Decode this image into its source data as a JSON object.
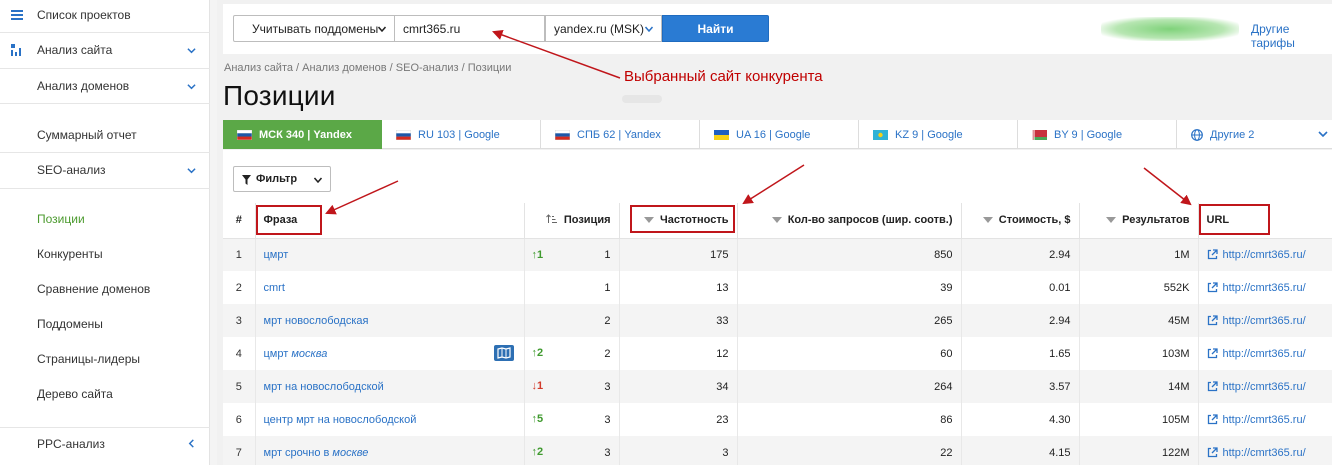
{
  "sidebar": {
    "projects_label": "Список проектов",
    "site_analysis_label": "Анализ сайта",
    "domain_analysis_label": "Анализ доменов",
    "summary_label": "Суммарный отчет",
    "seo_label": "SEO-анализ",
    "positions_label": "Позиции",
    "competitors_label": "Конкуренты",
    "compare_label": "Сравнение доменов",
    "subdomains_label": "Поддомены",
    "leaders_label": "Страницы-лидеры",
    "tree_label": "Дерево сайта",
    "ppc_label": "PPC-анализ"
  },
  "topbar": {
    "subdomains_label": "Учитывать поддомены",
    "domain_value": "cmrt365.ru",
    "region_value": "yandex.ru (MSK)",
    "find_label": "Найти",
    "other_tariffs_label": "Другие тарифы"
  },
  "breadcrumb": "Анализ сайта / Анализ доменов / SEO-анализ / Позиции",
  "page_title": "Позиции",
  "annotation_text": "Выбранный сайт конкурента",
  "tabs": [
    {
      "label": "МСК 340 | Yandex",
      "flag": "ru"
    },
    {
      "label": "RU 103 | Google",
      "flag": "ru"
    },
    {
      "label": "СПБ 62 | Yandex",
      "flag": "ru"
    },
    {
      "label": "UA 16 | Google",
      "flag": "ua"
    },
    {
      "label": "KZ 9 | Google",
      "flag": "kz"
    },
    {
      "label": "BY 9 | Google",
      "flag": "by"
    },
    {
      "label": "Другие 2",
      "flag": "globe"
    }
  ],
  "filter_label": "Фильтр",
  "table": {
    "headers": {
      "num": "#",
      "phrase": "Фраза",
      "position": "Позиция",
      "frequency": "Частотность",
      "queries": "Кол-во запросов (шир. соотв.)",
      "cost": "Стоимость, $",
      "results": "Результатов",
      "url": "URL"
    },
    "rows": [
      {
        "num": "1",
        "phrase": "цмрт",
        "phrase_italic": "",
        "change": "↑1",
        "change_dir": "up",
        "position": "1",
        "frequency": "175",
        "queries": "850",
        "cost": "2.94",
        "results": "1M",
        "url": "http://cmrt365.ru/",
        "map": false
      },
      {
        "num": "2",
        "phrase": "cmrt",
        "phrase_italic": "",
        "change": "",
        "change_dir": "",
        "position": "1",
        "frequency": "13",
        "queries": "39",
        "cost": "0.01",
        "results": "552K",
        "url": "http://cmrt365.ru/",
        "map": false
      },
      {
        "num": "3",
        "phrase": "мрт новослободская",
        "phrase_italic": "",
        "change": "",
        "change_dir": "",
        "position": "2",
        "frequency": "33",
        "queries": "265",
        "cost": "2.94",
        "results": "45M",
        "url": "http://cmrt365.ru/",
        "map": false
      },
      {
        "num": "4",
        "phrase": "цмрт ",
        "phrase_italic": "москва",
        "change": "↑2",
        "change_dir": "up",
        "position": "2",
        "frequency": "12",
        "queries": "60",
        "cost": "1.65",
        "results": "103M",
        "url": "http://cmrt365.ru/",
        "map": true
      },
      {
        "num": "5",
        "phrase": "мрт на новослободской",
        "phrase_italic": "",
        "change": "↓1",
        "change_dir": "down",
        "position": "3",
        "frequency": "34",
        "queries": "264",
        "cost": "3.57",
        "results": "14M",
        "url": "http://cmrt365.ru/",
        "map": false
      },
      {
        "num": "6",
        "phrase": "центр мрт на новослободской",
        "phrase_italic": "",
        "change": "↑5",
        "change_dir": "up",
        "position": "3",
        "frequency": "23",
        "queries": "86",
        "cost": "4.30",
        "results": "105M",
        "url": "http://cmrt365.ru/",
        "map": false
      },
      {
        "num": "7",
        "phrase": "мрт срочно в ",
        "phrase_italic": "москве",
        "change": "↑2",
        "change_dir": "up",
        "position": "3",
        "frequency": "3",
        "queries": "22",
        "cost": "4.15",
        "results": "122M",
        "url": "http://cmrt365.ru/",
        "map": false
      }
    ]
  },
  "colors": {
    "accent_green": "#5ba847",
    "link_blue": "#2a72c6",
    "button_blue": "#2a7bd3",
    "annotation_red": "#c0161b"
  }
}
